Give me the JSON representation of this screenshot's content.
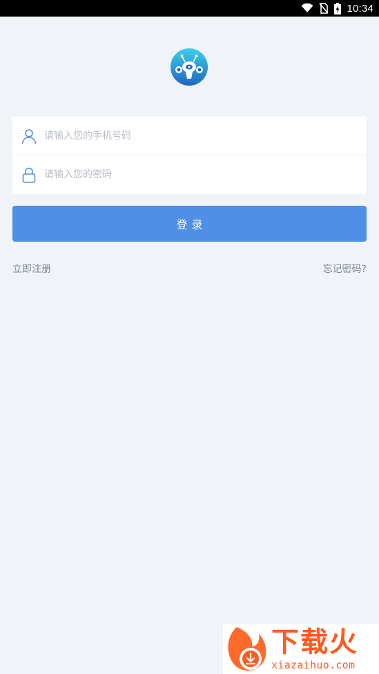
{
  "status_bar": {
    "time": "10:34",
    "icons": [
      "wifi-icon",
      "no-sim-icon",
      "battery-charging-icon"
    ]
  },
  "app": {
    "logo_icon": "app-logo-icon"
  },
  "login_form": {
    "phone": {
      "icon": "user-icon",
      "placeholder": "请输入您的手机号码",
      "value": ""
    },
    "password": {
      "icon": "lock-icon",
      "placeholder": "请输入您的密码",
      "value": ""
    },
    "login_label": "登录"
  },
  "links": {
    "register": "立即注册",
    "forgot_password": "忘记密码?"
  },
  "watermark": {
    "title": "下载火",
    "url": "xiazaihuo.com"
  },
  "colors": {
    "background": "#f0f3f8",
    "primary": "#4f8fe6",
    "icon": "#4f8fe6",
    "link_text": "#7d8590",
    "placeholder": "#b9bec6",
    "watermark": "#ff5a1f"
  }
}
